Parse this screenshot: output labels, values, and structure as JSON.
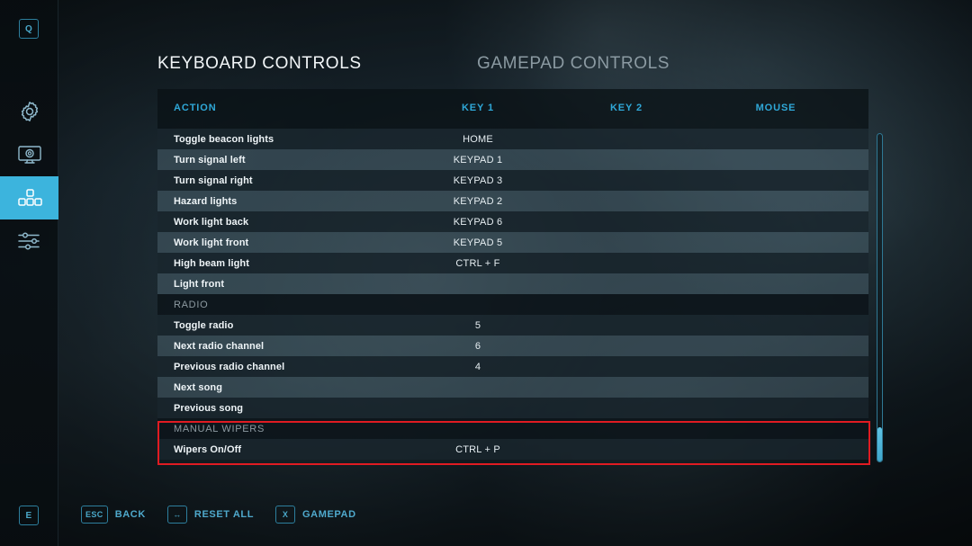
{
  "sidebar": {
    "top_key": "Q",
    "bottom_key": "E",
    "items": [
      {
        "name": "general-settings",
        "icon": "gear-icon",
        "active": false
      },
      {
        "name": "graphics-settings",
        "icon": "monitor-gear-icon",
        "active": false
      },
      {
        "name": "controls-settings",
        "icon": "controls-grid-icon",
        "active": true
      },
      {
        "name": "game-settings",
        "icon": "sliders-icon",
        "active": false
      }
    ]
  },
  "tabs": [
    {
      "label": "KEYBOARD CONTROLS",
      "active": true
    },
    {
      "label": "GAMEPAD CONTROLS",
      "active": false
    }
  ],
  "table": {
    "columns": [
      "ACTION",
      "KEY 1",
      "KEY 2",
      "MOUSE"
    ],
    "rows": [
      {
        "type": "entry",
        "action": "Toggle beacon lights",
        "key1": "HOME",
        "key2": "",
        "mouse": ""
      },
      {
        "type": "entry",
        "action": "Turn signal left",
        "key1": "KEYPAD 1",
        "key2": "",
        "mouse": ""
      },
      {
        "type": "entry",
        "action": "Turn signal right",
        "key1": "KEYPAD 3",
        "key2": "",
        "mouse": ""
      },
      {
        "type": "entry",
        "action": "Hazard lights",
        "key1": "KEYPAD 2",
        "key2": "",
        "mouse": ""
      },
      {
        "type": "entry",
        "action": "Work light back",
        "key1": "KEYPAD 6",
        "key2": "",
        "mouse": ""
      },
      {
        "type": "entry",
        "action": "Work light front",
        "key1": "KEYPAD 5",
        "key2": "",
        "mouse": ""
      },
      {
        "type": "entry",
        "action": "High beam light",
        "key1": "CTRL + F",
        "key2": "",
        "mouse": ""
      },
      {
        "type": "entry",
        "action": "Light front",
        "key1": "",
        "key2": "",
        "mouse": ""
      },
      {
        "type": "section",
        "action": "RADIO",
        "key1": "",
        "key2": "",
        "mouse": ""
      },
      {
        "type": "entry",
        "action": "Toggle radio",
        "key1": "5",
        "key2": "",
        "mouse": ""
      },
      {
        "type": "entry",
        "action": "Next radio channel",
        "key1": "6",
        "key2": "",
        "mouse": ""
      },
      {
        "type": "entry",
        "action": "Previous radio channel",
        "key1": "4",
        "key2": "",
        "mouse": ""
      },
      {
        "type": "entry",
        "action": "Next song",
        "key1": "",
        "key2": "",
        "mouse": ""
      },
      {
        "type": "entry",
        "action": "Previous song",
        "key1": "",
        "key2": "",
        "mouse": ""
      },
      {
        "type": "section",
        "action": "MANUAL WIPERS",
        "key1": "",
        "key2": "",
        "mouse": ""
      },
      {
        "type": "entry",
        "action": "Wipers On/Off",
        "key1": "CTRL + P",
        "key2": "",
        "mouse": ""
      }
    ]
  },
  "hints": [
    {
      "key": "ESC",
      "label": "BACK",
      "icon": ""
    },
    {
      "key": "↔",
      "label": "RESET ALL",
      "icon": "left-right-arrow-icon"
    },
    {
      "key": "X",
      "label": "GAMEPAD",
      "icon": ""
    }
  ],
  "colors": {
    "accent": "#3cb4dd",
    "header_text": "#2fa8d8",
    "highlight_box": "#e01b22",
    "hint_text": "#4fa9cc"
  }
}
